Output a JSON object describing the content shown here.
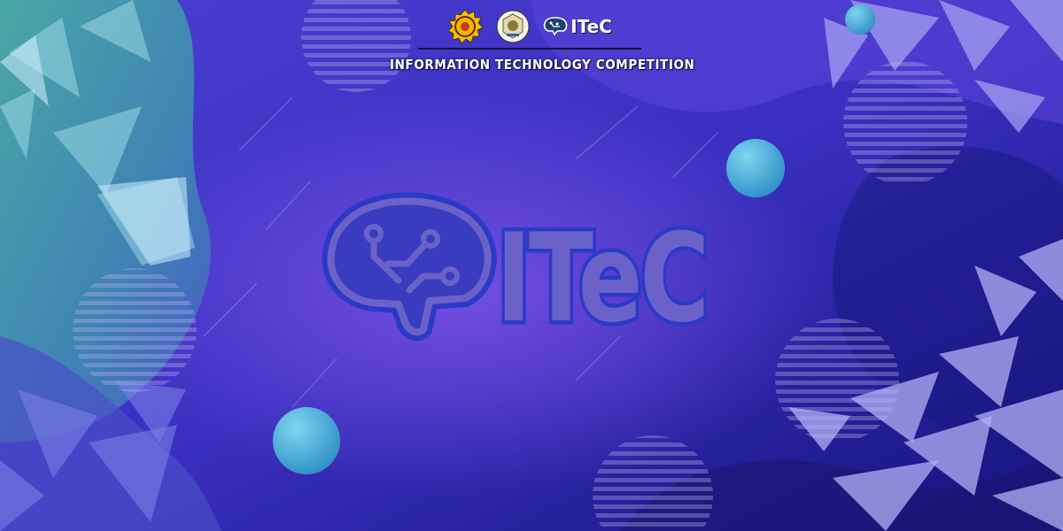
{
  "header": {
    "small_logo_text": "ITeC",
    "subtitle": "INFORMATION TECHNOLOGY COMPETITION"
  },
  "main_logo": {
    "wordmark": "ITeC"
  },
  "colors": {
    "background_deep": "#1b1680",
    "background_purple": "#5b3fd6",
    "background_teal": "#3fa3b0",
    "logo_fill": "#6b62c9",
    "logo_outline": "#2b3ac6",
    "sphere": "#58bde0"
  },
  "icons": [
    "university-seal-icon",
    "faculty-badge-icon",
    "brain-circuit-icon"
  ]
}
